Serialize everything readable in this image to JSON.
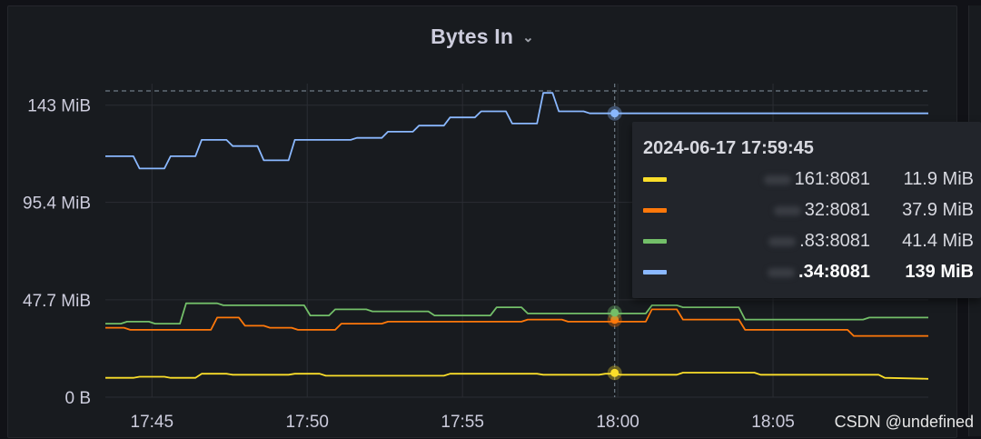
{
  "panel": {
    "title": "Bytes In"
  },
  "chart_data": {
    "type": "line",
    "title": "Bytes In",
    "xlabel": "",
    "ylabel": "",
    "x_range_minutes": [
      17.25,
      18.1
    ],
    "xlim_time": [
      "17:43:15",
      "18:09:45"
    ],
    "ylim": [
      0,
      150
    ],
    "y_ticks": [
      {
        "value": 0,
        "label": "0 B"
      },
      {
        "value": 47.7,
        "label": "47.7 MiB"
      },
      {
        "value": 95.4,
        "label": "95.4 MiB"
      },
      {
        "value": 143,
        "label": "143 MiB"
      }
    ],
    "x_ticks": [
      {
        "value": 1.5,
        "label": "17:45"
      },
      {
        "value": 6.5,
        "label": "17:50"
      },
      {
        "value": 11.5,
        "label": "17:55"
      },
      {
        "value": 16.5,
        "label": "18:00"
      },
      {
        "value": 21.5,
        "label": "18:05"
      }
    ],
    "threshold": 150,
    "grid": true,
    "cursor_time": "2024-06-17 17:59:45",
    "series": [
      {
        "name": "161:8081",
        "color": "#fade2a",
        "x": [
          0,
          0.9,
          1.1,
          1.9,
          2.1,
          2.9,
          3.1,
          3.9,
          4.1,
          5.9,
          6.1,
          6.9,
          7.1,
          10.9,
          11.1,
          13.9,
          14.1,
          15.9,
          16.1,
          16.4,
          16.6,
          18.4,
          18.6,
          20.9,
          21.1,
          24.9,
          25.1,
          26.5
        ],
        "y": [
          9.5,
          9.5,
          10,
          10,
          9.5,
          9.5,
          11.5,
          11.5,
          11,
          11,
          11.5,
          11.5,
          10.5,
          10.5,
          11.5,
          11.5,
          11,
          11,
          11.5,
          11.5,
          11,
          11,
          12,
          12,
          11,
          11,
          9.5,
          9
        ]
      },
      {
        "name": "32:8081",
        "color": "#ff780a",
        "x": [
          0,
          0.6,
          0.8,
          3.4,
          3.6,
          4.3,
          4.5,
          5.1,
          5.3,
          6.0,
          6.2,
          7.4,
          7.6,
          8.9,
          9.1,
          13.4,
          13.6,
          14.7,
          14.9,
          17.4,
          17.6,
          18.4,
          18.6,
          20.4,
          20.6,
          23.9,
          24.1,
          26.5
        ],
        "y": [
          34,
          34,
          33,
          33,
          39,
          39,
          35,
          35,
          34,
          34,
          33,
          33,
          36,
          36,
          37,
          37,
          38,
          38,
          37,
          37,
          43,
          43,
          38,
          38,
          33,
          33,
          30,
          30
        ]
      },
      {
        "name": "83:8081",
        "color": "#73bf69",
        "x": [
          0,
          0.5,
          0.7,
          1.4,
          1.6,
          2.4,
          2.6,
          3.6,
          3.8,
          6.4,
          6.6,
          7.2,
          7.4,
          8.4,
          8.6,
          10.4,
          10.6,
          12.4,
          12.6,
          13.4,
          13.6,
          17.4,
          17.6,
          18.4,
          18.6,
          20.4,
          20.6,
          24.4,
          24.6,
          26.5
        ],
        "y": [
          36,
          36,
          37,
          37,
          36,
          36,
          46,
          46,
          45,
          45,
          40,
          40,
          43,
          43,
          42,
          42,
          40,
          40,
          44,
          44,
          41,
          41,
          45,
          45,
          44,
          44,
          38,
          38,
          39,
          39
        ]
      },
      {
        "name": "34:8081",
        "color": "#8ab8ff",
        "x": [
          0,
          0.9,
          1.1,
          1.9,
          2.1,
          2.9,
          3.1,
          3.9,
          4.1,
          4.9,
          5.1,
          5.9,
          6.1,
          7.9,
          8.1,
          8.9,
          9.1,
          9.9,
          10.1,
          10.9,
          11.1,
          11.9,
          12.1,
          12.9,
          13.1,
          13.9,
          14.1,
          14.4,
          14.6,
          15.4,
          15.6,
          16.4,
          16.6,
          26.5
        ],
        "y": [
          118,
          118,
          112,
          112,
          118,
          118,
          126,
          126,
          123,
          123,
          116,
          116,
          126,
          126,
          127,
          127,
          130,
          130,
          133,
          133,
          137,
          137,
          140,
          140,
          134,
          134,
          149,
          149,
          140,
          140,
          139,
          139,
          139,
          139
        ]
      }
    ]
  },
  "tooltip": {
    "time": "2024-06-17 17:59:45",
    "rows": [
      {
        "name": "161:8081",
        "value": "11.9 MiB",
        "color": "#fade2a",
        "active": false
      },
      {
        "name": "32:8081",
        "value": "37.9 MiB",
        "color": "#ff780a",
        "active": false
      },
      {
        "name": ".83:8081",
        "value": "41.4 MiB",
        "color": "#73bf69",
        "active": false
      },
      {
        "name": ".34:8081",
        "value": "139 MiB",
        "color": "#8ab8ff",
        "active": true
      }
    ]
  },
  "watermark": "CSDN @undefined",
  "colors": {
    "background": "#111217",
    "panel": "#181b1f",
    "grid": "#2c2f35",
    "text": "#ccccdc"
  }
}
